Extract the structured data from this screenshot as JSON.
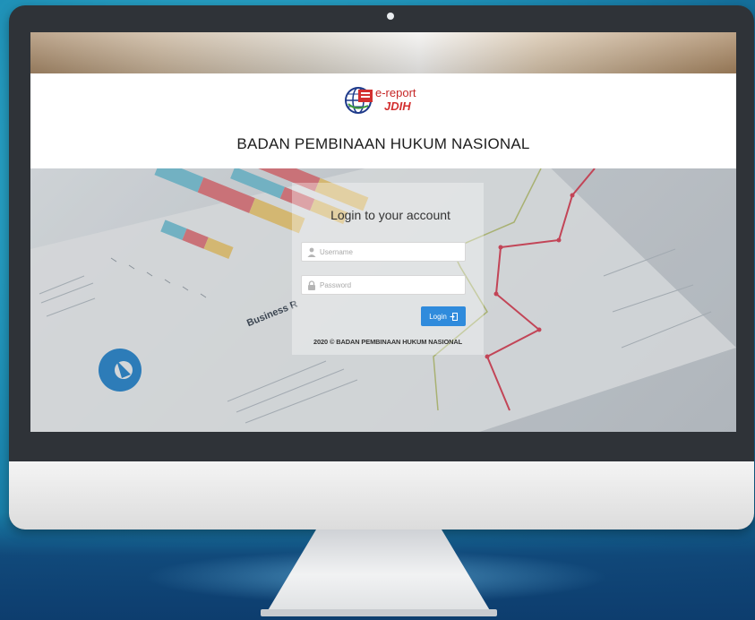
{
  "header": {
    "logo_text_top": "e-report",
    "logo_text_bottom": "JDIH",
    "title": "BADAN PEMBINAAN HUKUM NASIONAL"
  },
  "login": {
    "title": "Login to your account",
    "username_placeholder": "Username",
    "password_placeholder": "Password",
    "button_label": "Login",
    "footer": "2020 © BADAN PEMBINAAN HUKUM NASIONAL"
  },
  "background_doc": {
    "caption": "Business R"
  },
  "icons": [
    "user-icon",
    "lock-icon",
    "login-arrow-icon",
    "globe-logo-icon"
  ],
  "colors": {
    "primary_button": "#2f8bdc",
    "logo_red": "#c62828",
    "chart_line_red": "#e0455a",
    "chart_line_olive": "#c0c87a",
    "bar_teal": "#7ec8dc",
    "bar_red": "#e87c82",
    "bar_yellow": "#f4d07a",
    "page_background": "#1e8fb6"
  }
}
